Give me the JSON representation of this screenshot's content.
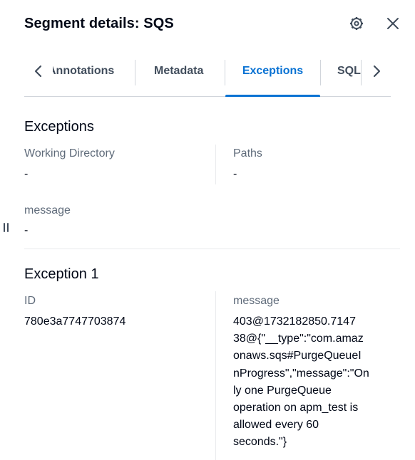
{
  "header": {
    "title": "Segment details: SQS",
    "settings_icon": "gear-icon",
    "close_icon": "close-icon"
  },
  "tabs": {
    "items": [
      {
        "label": "Annotations"
      },
      {
        "label": "Metadata"
      },
      {
        "label": "Exceptions"
      },
      {
        "label": "SQL"
      }
    ],
    "active": "Exceptions",
    "prev_icon": "chevron-left-icon",
    "next_icon": "chevron-right-icon"
  },
  "exceptions": {
    "title": "Exceptions",
    "working_directory": {
      "label": "Working Directory",
      "value": "-"
    },
    "paths": {
      "label": "Paths",
      "value": "-"
    },
    "message": {
      "label": "message",
      "value": "-"
    }
  },
  "exception_1": {
    "title": "Exception 1",
    "id": {
      "label": "ID",
      "value": "780e3a7747703874"
    },
    "message": {
      "label": "message",
      "lines": [
        "403@1732182850.7147",
        "38@{\"__type\":\"com.amaz",
        "onaws.sqs#PurgeQueueI",
        "nProgress\",\"message\":\"On",
        "ly one PurgeQueue",
        "operation on apm_test is",
        "allowed every 60",
        "seconds.\"}"
      ]
    }
  }
}
